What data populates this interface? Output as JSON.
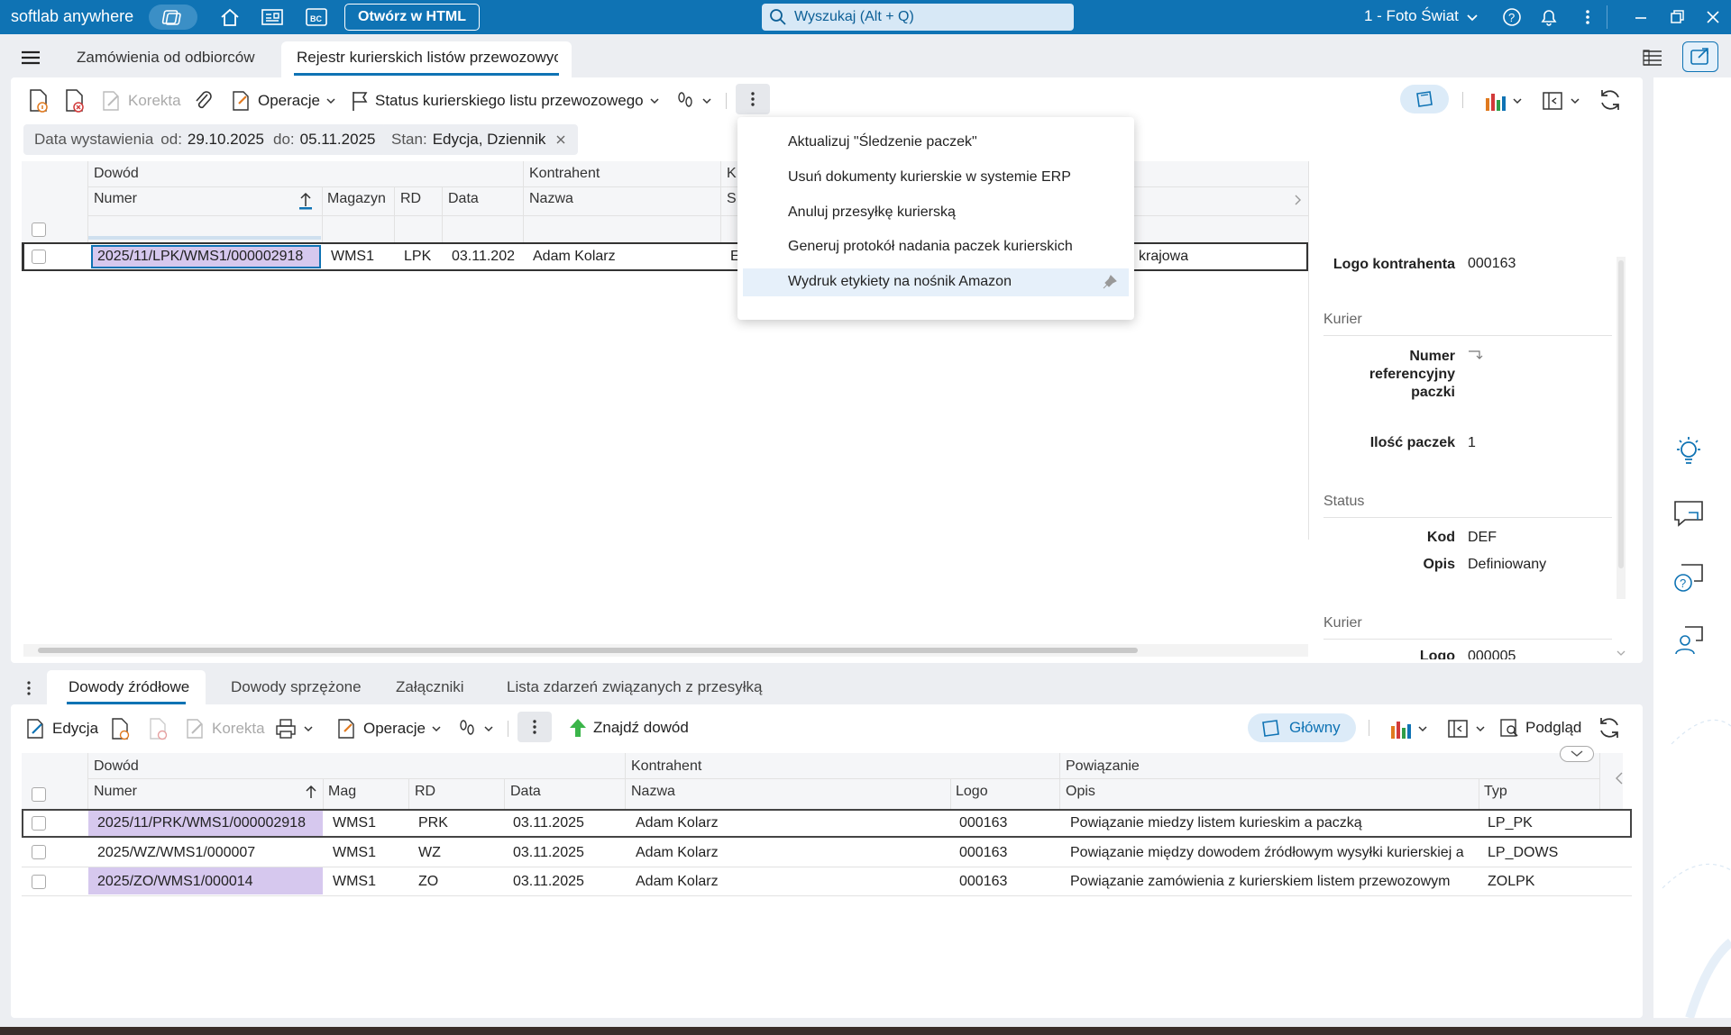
{
  "app": {
    "name": "softlab anywhere",
    "html_button": "Otwórz w HTML",
    "search_placeholder": "Wyszukaj (Alt + Q)",
    "company": "1 - Foto Świat"
  },
  "tabs": [
    {
      "label": "Zamówienia od odbiorców"
    },
    {
      "label": "Rejestr kurierskich listów przewozowych"
    }
  ],
  "toolbar": {
    "korekta": "Korekta",
    "operacje": "Operacje",
    "status": "Status kurierskiego listu przewozowego"
  },
  "filters": {
    "data_label": "Data wystawienia",
    "od_label": "od:",
    "od": "29.10.2025",
    "do_label": "do:",
    "do": "05.11.2025",
    "stan_label": "Stan:",
    "stan": "Edycja, Dziennik"
  },
  "grid": {
    "group_dowod": "Dowód",
    "group_kontrahent": "Kontrahent",
    "group_k": "K",
    "col_numer": "Numer",
    "col_magazyn": "Magazyn",
    "col_rd": "RD",
    "col_data": "Data",
    "col_nazwa": "Nazwa",
    "col_s": "S",
    "row": {
      "numer": "2025/11/LPK/WMS1/000002918",
      "magazyn": "WMS1",
      "rd": "LPK",
      "data": "03.11.202",
      "nazwa": "Adam Kolarz",
      "k": "E",
      "extra": "krajowa"
    }
  },
  "menu": {
    "items": [
      "Aktualizuj \"Śledzenie paczek\"",
      "Usuń dokumenty kurierskie w systemie ERP",
      "Anuluj przesyłkę kurierską",
      "Generuj protokół nadania paczek kurierskich",
      "Wydruk etykiety na nośnik Amazon"
    ]
  },
  "details": {
    "logo_label": "Logo kontrahenta",
    "logo_value": "000163",
    "sec_kurier": "Kurier",
    "nr_label": "Numer referencyjny paczki",
    "ilosc_label": "Ilość paczek",
    "ilosc_value": "1",
    "sec_status": "Status",
    "kod_label": "Kod",
    "kod_value": "DEF",
    "opis_label": "Opis",
    "opis_value": "Definiowany",
    "sec_kurier2": "Kurier",
    "logo2_label": "Logo",
    "logo2_value": "000005"
  },
  "bottom_tabs": [
    "Dowody źródłowe",
    "Dowody sprzężone",
    "Załączniki",
    "Lista zdarzeń związanych z przesyłką"
  ],
  "bottom_toolbar": {
    "edycja": "Edycja",
    "korekta": "Korekta",
    "operacje": "Operacje",
    "znajdz": "Znajdź dowód",
    "glowny": "Główny",
    "podglad": "Podgląd"
  },
  "bgrid": {
    "group_dowod": "Dowód",
    "group_kontrahent": "Kontrahent",
    "group_powiazanie": "Powiązanie",
    "col_numer": "Numer",
    "col_mag": "Mag",
    "col_rd": "RD",
    "col_data": "Data",
    "col_nazwa": "Nazwa",
    "col_logo": "Logo",
    "col_opis": "Opis",
    "col_typ": "Typ",
    "rows": [
      {
        "numer": "2025/11/PRK/WMS1/000002918",
        "mag": "WMS1",
        "rd": "PRK",
        "data": "03.11.2025",
        "nazwa": "Adam Kolarz",
        "logo": "000163",
        "opis": "Powiązanie miedzy listem kurieskim a paczką",
        "typ": "LP_PK"
      },
      {
        "numer": "2025/WZ/WMS1/000007",
        "mag": "WMS1",
        "rd": "WZ",
        "data": "03.11.2025",
        "nazwa": "Adam Kolarz",
        "logo": "000163",
        "opis": "Powiązanie między dowodem źródłowym wysyłki kurierskiej a",
        "typ": "LP_DOWS"
      },
      {
        "numer": "2025/ZO/WMS1/000014",
        "mag": "WMS1",
        "rd": "ZO",
        "data": "03.11.2025",
        "nazwa": "Adam Kolarz",
        "logo": "000163",
        "opis": "Powiązanie zamówienia z kurierskiem listem przewozowym",
        "typ": "ZOLPK"
      }
    ]
  },
  "colors": {
    "accent": "#0f73b4",
    "highlight": "#d6c8ee"
  }
}
